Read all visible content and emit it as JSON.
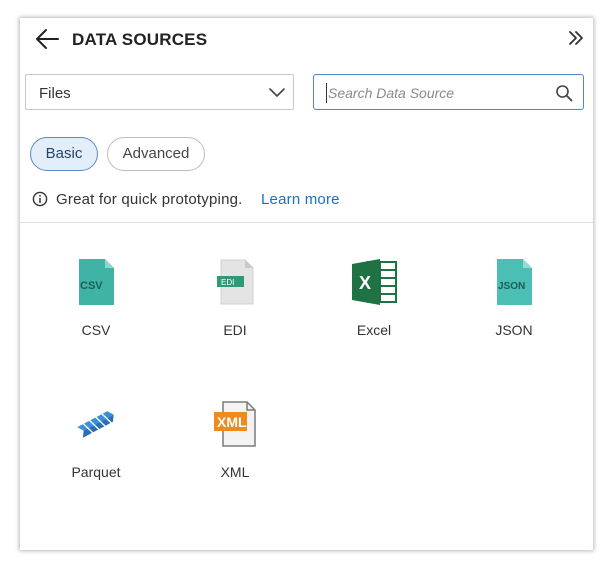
{
  "header": {
    "title": "DATA SOURCES"
  },
  "filter": {
    "selected": "Files"
  },
  "search": {
    "placeholder": "Search Data Source",
    "value": ""
  },
  "tabs": [
    {
      "label": "Basic",
      "active": true
    },
    {
      "label": "Advanced",
      "active": false
    }
  ],
  "info": {
    "text": "Great for quick prototyping.",
    "link": "Learn more"
  },
  "sources": [
    {
      "label": "CSV",
      "icon": "csv-file-icon",
      "badge": "CSV"
    },
    {
      "label": "EDI",
      "icon": "edi-file-icon",
      "badge": "EDI"
    },
    {
      "label": "Excel",
      "icon": "excel-file-icon",
      "badge": "X"
    },
    {
      "label": "JSON",
      "icon": "json-file-icon",
      "badge": "JSON"
    },
    {
      "label": "Parquet",
      "icon": "parquet-icon"
    },
    {
      "label": "XML",
      "icon": "xml-file-icon",
      "badge": "XML"
    }
  ],
  "colors": {
    "accent": "#1a6fc9",
    "active_pill_bg": "#e4eefa",
    "active_pill_border": "#5a8bc7",
    "csv_teal": "#3fb3a6",
    "json_teal": "#4bbfb3",
    "excel_green": "#1f7244",
    "xml_orange": "#f0891e",
    "parquet_blue": "#3a8fd8"
  }
}
